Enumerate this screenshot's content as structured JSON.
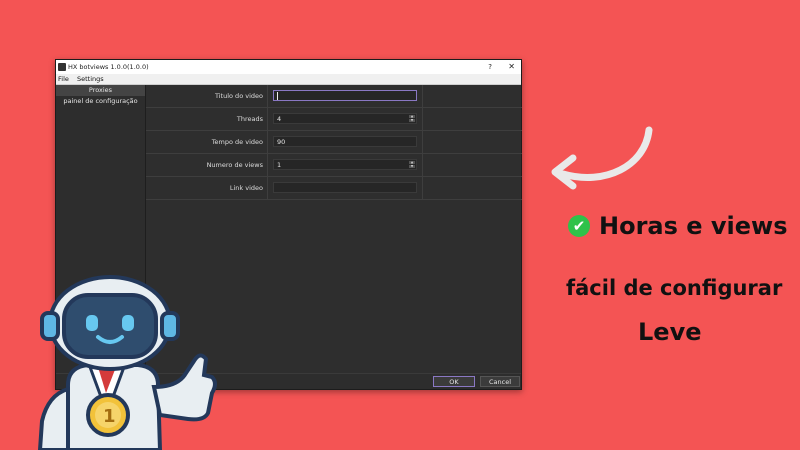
{
  "window": {
    "title": "HX botviews 1.0.0(1.0.0)",
    "help_glyph": "?",
    "close_glyph": "✕"
  },
  "menu": [
    "File",
    "Settings"
  ],
  "sidebar": {
    "items": [
      {
        "label": "Proxies",
        "active": true
      },
      {
        "label": "painel de configuração",
        "active": false
      }
    ]
  },
  "form": {
    "rows": [
      {
        "label": "Titulo do video",
        "value": "",
        "focused": true,
        "spin": false
      },
      {
        "label": "Threads",
        "value": "4",
        "focused": false,
        "spin": true
      },
      {
        "label": "Tempo de video",
        "value": "90",
        "focused": false,
        "spin": false
      },
      {
        "label": "Numero de views",
        "value": "1",
        "focused": false,
        "spin": true
      },
      {
        "label": "Link video",
        "value": "",
        "focused": false,
        "spin": false
      }
    ]
  },
  "buttons": {
    "ok": "OK",
    "cancel": "Cancel"
  },
  "promo": {
    "line1": "Horas e views",
    "line2": "fácil de configurar",
    "line3": "Leve",
    "check_glyph": "✔"
  },
  "colors": {
    "background": "#f45454",
    "accent": "#8a78c4",
    "check": "#2fc24a"
  }
}
